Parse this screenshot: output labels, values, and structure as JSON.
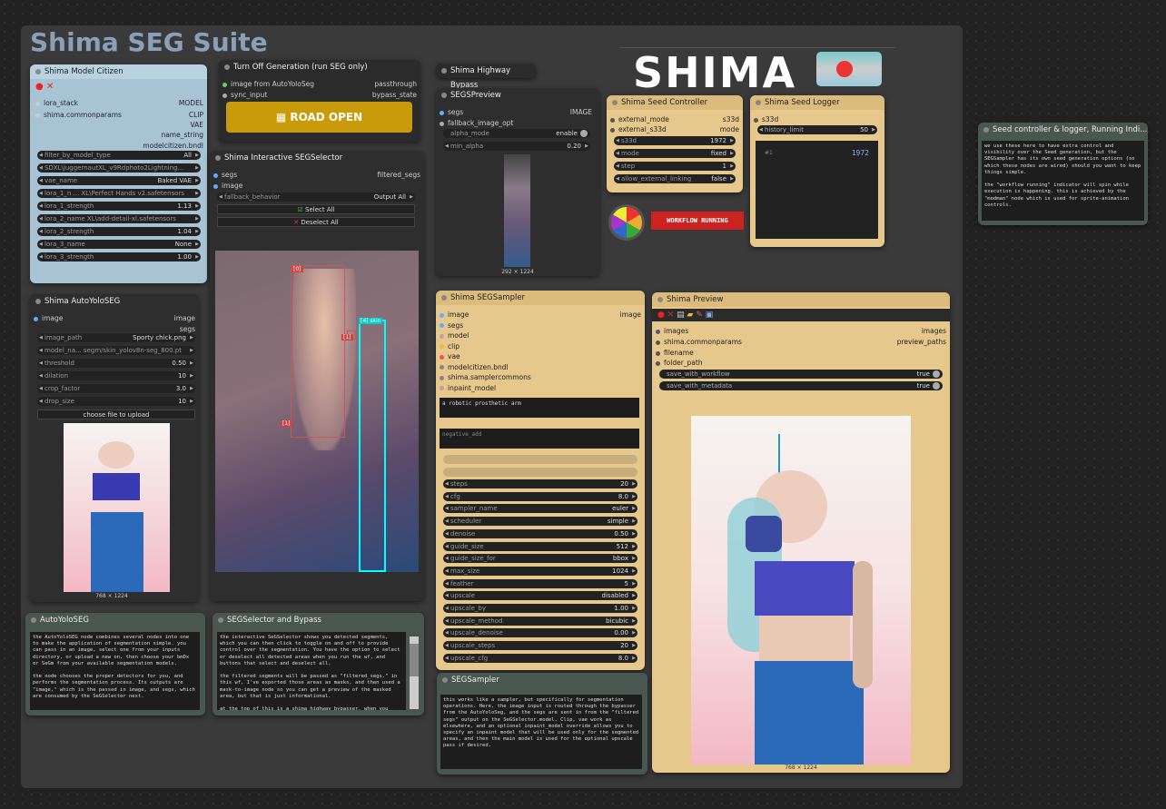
{
  "title": "Shima SEG Suite",
  "model_citizen": {
    "title": "Shima Model Citizen",
    "inputs": [
      "lora_stack",
      "shima.commonparams"
    ],
    "outputs": [
      "MODEL",
      "CLIP",
      "VAE",
      "name_string",
      "modelcitizen.bndl"
    ],
    "widgets": [
      {
        "name": "filter_by_model_type",
        "value": "All"
      },
      {
        "name": "SDXL\\juggernautXL_v9Rdphoto2Lightning...",
        "value": ""
      },
      {
        "name": "vae_name",
        "value": "Baked VAE"
      },
      {
        "name": "lora_1_n ... XL\\Perfect Hands v2.safetensors",
        "value": ""
      },
      {
        "name": "lora_1_strength",
        "value": "1.13"
      },
      {
        "name": "lora_2_name XL\\add-detail-xl.safetensors",
        "value": ""
      },
      {
        "name": "lora_2_strength",
        "value": "1.04"
      },
      {
        "name": "lora_3_name",
        "value": "None"
      },
      {
        "name": "lora_3_strength",
        "value": "1.00"
      }
    ]
  },
  "turn_off": {
    "title": "Turn Off Generation (run SEG only)",
    "in1": "image from AutoYoloSeg",
    "in2": "sync_input",
    "out1": "passthrough",
    "out2": "bypass_state",
    "button": "ROAD OPEN"
  },
  "highway": {
    "title": "Shima Highway Bypass"
  },
  "segs_preview": {
    "title": "SEGSPreview",
    "in1": "segs",
    "in2": "fallback_image_opt",
    "out": "IMAGE",
    "w1": "alpha_mode",
    "w1v": "enable",
    "w2": "min_alpha",
    "w2v": "0.20",
    "size": "292 × 1224"
  },
  "selector": {
    "title": "Shima Interactive SEGSelector",
    "in1": "segs",
    "in2": "image",
    "out": "filtered_segs",
    "w1": "fallback_behavior",
    "w1v": "Output All",
    "select_all": "Select All",
    "deselect_all": "Deselect All",
    "tags": [
      "[0]",
      "[3]",
      "[4] skin",
      "[1]"
    ]
  },
  "seed_ctrl": {
    "title": "Shima Seed Controller",
    "in1": "external_mode",
    "in2": "external_s33d",
    "out1": "s33d",
    "out2": "mode",
    "w": [
      {
        "name": "s33d",
        "value": "1972"
      },
      {
        "name": "mode",
        "value": "fixed"
      },
      {
        "name": "step",
        "value": "1"
      },
      {
        "name": "allow_external_linking",
        "value": "false"
      }
    ]
  },
  "seed_logger": {
    "title": "Shima Seed Logger",
    "in": "s33d",
    "w": "history_limit",
    "wv": "50",
    "log_idx": "#1",
    "log_val": "1972"
  },
  "workflow_running": "WORKFLOW RUNNING",
  "logo": "SHIMA",
  "note_seed": {
    "title": "Seed controller & logger, Running Indi...",
    "text": "we use these here to have extra control and visibility over the Seed generation, but the SEGSampler has its own seed generation options (so which these nodes are wired) should you want to keep things simple.\n\nthe \"workflow running\" indicator will spin while execution is happening. this is achieved by the \"modman\" node which is used for sprite-animation controls."
  },
  "autoyolo": {
    "title": "Shima AutoYoloSEG",
    "in": "image",
    "out1": "image",
    "out2": "segs",
    "w": [
      {
        "name": "image_path",
        "value": "Sporty chick.png"
      },
      {
        "name": "model_na... segm/skin_yolov8n-seg_800.pt",
        "value": ""
      },
      {
        "name": "threshold",
        "value": "0.50"
      },
      {
        "name": "dilation",
        "value": "10"
      },
      {
        "name": "crop_factor",
        "value": "3.0"
      },
      {
        "name": "drop_size",
        "value": "10"
      }
    ],
    "upload": "choose file to upload",
    "size": "768 × 1224"
  },
  "sampler": {
    "title": "Shima SEGSampler",
    "inputs": [
      "image",
      "segs",
      "model",
      "clip",
      "vae",
      "modelcitizen.bndl",
      "shima.samplercommons",
      "inpaint_model"
    ],
    "out": "image",
    "positive": "a robotic prosthetic arm",
    "negative": "negative_add",
    "w": [
      {
        "name": "steps",
        "value": "20"
      },
      {
        "name": "cfg",
        "value": "8.0"
      },
      {
        "name": "sampler_name",
        "value": "euler"
      },
      {
        "name": "scheduler",
        "value": "simple"
      },
      {
        "name": "denoise",
        "value": "0.50"
      },
      {
        "name": "guide_size",
        "value": "512"
      },
      {
        "name": "guide_size_for",
        "value": "bbox"
      },
      {
        "name": "max_size",
        "value": "1024"
      },
      {
        "name": "feather",
        "value": "5"
      },
      {
        "name": "upscale",
        "value": "disabled"
      },
      {
        "name": "upscale_by",
        "value": "1.00"
      },
      {
        "name": "upscale_method",
        "value": "bicubic"
      },
      {
        "name": "upscale_denoise",
        "value": "0.00"
      },
      {
        "name": "upscale_steps",
        "value": "20"
      },
      {
        "name": "upscale_cfg",
        "value": "8.0"
      }
    ]
  },
  "preview": {
    "title": "Shima Preview",
    "in1": "images",
    "in2": "shima.commonparams",
    "in3": "filename",
    "in4": "folder_path",
    "out1": "images",
    "out2": "preview_paths",
    "w1": "save_with_workflow",
    "w1v": "true",
    "w2": "save_with_metadata",
    "w2v": "true",
    "size": "768 × 1224"
  },
  "note_autoyolo": {
    "title": "AutoYoloSEG",
    "text": "the AutoYoloSEG node combines several nodes into one to make the application of segmentation simple. you can pass in an image, select one from your inputs directory, or upload a new on, then choose your bmDx or SeGm from your available segmentation models.\n\nthe node chooses the proper detectors for you, and performs the segmentation process. Its outputs are \"image,\" which is the passed in image, and segs, which are consumed by the SeGSelector next."
  },
  "note_selector": {
    "title": "SEGSelector and Bypass",
    "text": "the interactive SeGSelector shows you detected segments, which you can then click to toggle on and off to provide control over the segmentation. You have the option to select or deselect all detected areas when you run the wf, and buttons that select and deselect all.\n\nthe filtered segments will be passed as \"filtered_segs.\" in this wf, I've exported those areas as masks, and then used a mask-to-image node so you can get a preview of the masked area, but that is just informational.\n\nat the top of this is a shima highway bypasser. when you"
  },
  "note_sampler": {
    "title": "SEGSampler",
    "text": "this works like a sampler, but specifically for segmentation operations. Here, the image input is routed through the bypasser from the AutoYoloSeg, and the segs are sent in from the \"filtered segs\" output on the SeGSelector.model, Clip, vae work as elsewhere, and an optional inpaint_model override allows you to specify an inpaint model that will be used only for the segmented areas, and then the main model is used for the optional upscale pass if desired."
  }
}
